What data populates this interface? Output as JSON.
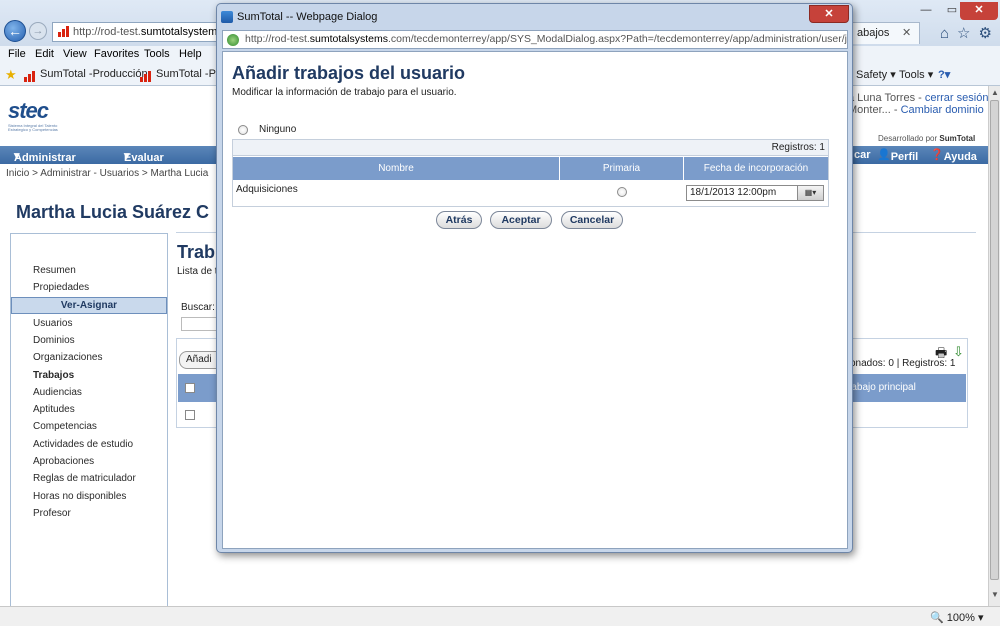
{
  "browser": {
    "url": "http://rod-test.sumtotalsystems.com/",
    "url_domain": "sumtotalsystems",
    "tab_label": "abajos",
    "menu": [
      "File",
      "Edit",
      "View",
      "Favorites",
      "Tools",
      "Help"
    ],
    "favorites": [
      "SumTotal -Producción",
      "SumTotal -Pru"
    ],
    "commands": [
      "Safety",
      "Tools"
    ],
    "zoom": "100%"
  },
  "page": {
    "user_name": "a Luna Torres",
    "logout": "cerrar sesión",
    "domain": "Monter...",
    "change_domain": "Cambiar dominio",
    "developed_by": "Desarrollado por",
    "developed_brand": "SumTotal",
    "nav": [
      "Administrar",
      "Evaluar"
    ],
    "nav_right": [
      "car",
      "Perfil",
      "Ayuda"
    ],
    "breadcrumb": "Inicio > Administrar - Usuarios > Martha Lucia",
    "person_title": "Martha Lucia Suárez C",
    "sidebar": {
      "items_top": [
        "Resumen",
        "Propiedades"
      ],
      "active": "Ver-Asignar",
      "items": [
        "Usuarios",
        "Dominios",
        "Organizaciones",
        "Trabajos",
        "Audiencias",
        "Aptitudes",
        "Competencias",
        "Actividades de estudio",
        "Aprobaciones",
        "Reglas de matriculador",
        "Horas no disponibles",
        "Profesor"
      ]
    },
    "main_heading": "Trab",
    "main_sub": "Lista de t",
    "search_label": "Buscar:",
    "add_button": "Añadi",
    "records_right": "onados: 0 | Registros: 1",
    "grid_header_right": "rabajo principal"
  },
  "dialog": {
    "title": "SumTotal -- Webpage Dialog",
    "url": "http://rod-test.sumtotalsystems.com/tecdemonterrey/app/SYS_ModalDialog.aspx?Path=/tecdemonterrey/app/administration/user/job/ADM_List",
    "url_domain": "sumtotalsystems",
    "heading": "Añadir trabajos del usuario",
    "subheading": "Modificar la información de trabajo para el usuario.",
    "none_option": "Ninguno",
    "records": "Registros: 1",
    "columns": [
      "Nombre",
      "Primaria",
      "Fecha de incorporación"
    ],
    "rows": [
      {
        "name": "Adquisiciones",
        "date": "18/1/2013 12:00pm"
      }
    ],
    "buttons": {
      "back": "Atrás",
      "accept": "Aceptar",
      "cancel": "Cancelar"
    }
  }
}
